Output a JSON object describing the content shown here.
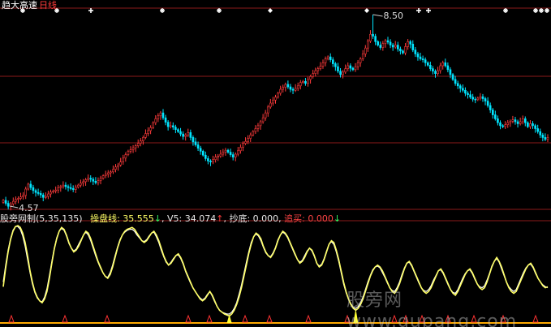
{
  "header": {
    "name": "趋大高速",
    "period": "日线"
  },
  "indicator": {
    "name": "股旁网制",
    "params": "(5,35,135)",
    "lines": [
      {
        "key": "操盘线",
        "value": "35.555",
        "arrow": "↓",
        "arrow_dir": "down",
        "color": "#ffff66"
      },
      {
        "key": "V5",
        "value": "34.074",
        "arrow": "↑",
        "arrow_dir": "up",
        "color": "#e6e6e6"
      },
      {
        "key": "抄底",
        "value": "0.000",
        "arrow": "",
        "arrow_dir": "",
        "color": "#ff66ff"
      },
      {
        "key": "追买",
        "value": "0.000",
        "arrow": "↓",
        "arrow_dir": "down",
        "color": "#ff4444"
      }
    ]
  },
  "watermark": "股旁网 www.gupang.com",
  "colors": {
    "up": "#ff3b3b",
    "down": "#00e5ff",
    "grid": "#8b1a1a",
    "osc_main": "#ffff66",
    "osc_signal": "#ffffff"
  },
  "chart_data": [
    {
      "type": "candlestick",
      "price_min": 4.57,
      "price_max": 8.5,
      "annotations": [
        {
          "text": "8.50",
          "bar": 148,
          "value": 8.5
        },
        {
          "text": "4.57",
          "bar": 2,
          "value": 4.57
        }
      ],
      "close": [
        4.72,
        4.66,
        4.6,
        4.65,
        4.7,
        4.74,
        4.76,
        4.79,
        4.82,
        4.95,
        5.05,
        4.98,
        4.92,
        4.88,
        4.86,
        4.83,
        4.78,
        4.8,
        4.85,
        4.89,
        4.91,
        4.93,
        4.98,
        5.0,
        5.03,
        5.0,
        4.98,
        4.96,
        4.94,
        4.99,
        5.03,
        5.07,
        5.1,
        5.14,
        5.17,
        5.15,
        5.11,
        5.08,
        5.12,
        5.17,
        5.22,
        5.25,
        5.28,
        5.3,
        5.35,
        5.4,
        5.44,
        5.5,
        5.58,
        5.65,
        5.72,
        5.75,
        5.79,
        5.83,
        5.88,
        5.93,
        6.0,
        6.08,
        6.14,
        6.2,
        6.3,
        6.38,
        6.44,
        6.5,
        6.4,
        6.31,
        6.22,
        6.24,
        6.21,
        6.16,
        6.12,
        6.07,
        6.02,
        6.05,
        6.1,
        6.0,
        5.91,
        5.85,
        5.78,
        5.72,
        5.64,
        5.57,
        5.52,
        5.5,
        5.55,
        5.6,
        5.62,
        5.66,
        5.7,
        5.74,
        5.7,
        5.65,
        5.6,
        5.66,
        5.73,
        5.8,
        5.88,
        5.92,
        5.98,
        6.05,
        6.12,
        6.18,
        6.24,
        6.32,
        6.4,
        6.5,
        6.62,
        6.7,
        6.76,
        6.82,
        6.9,
        6.98,
        7.02,
        7.08,
        7.03,
        6.98,
        6.96,
        7.0,
        7.05,
        7.12,
        7.14,
        7.1,
        7.18,
        7.24,
        7.3,
        7.36,
        7.4,
        7.45,
        7.52,
        7.6,
        7.64,
        7.58,
        7.5,
        7.44,
        7.35,
        7.28,
        7.33,
        7.4,
        7.46,
        7.41,
        7.38,
        7.44,
        7.52,
        7.6,
        7.7,
        7.82,
        7.96,
        8.1,
        8.06,
        7.95,
        7.88,
        7.83,
        7.91,
        7.97,
        7.94,
        7.88,
        7.84,
        7.88,
        7.8,
        7.76,
        7.72,
        7.85,
        7.95,
        7.9,
        7.78,
        7.7,
        7.64,
        7.6,
        7.58,
        7.52,
        7.47,
        7.4,
        7.35,
        7.3,
        7.36,
        7.46,
        7.52,
        7.46,
        7.38,
        7.28,
        7.18,
        7.1,
        7.05,
        7.0,
        6.96,
        6.9,
        6.87,
        6.82,
        6.78,
        6.77,
        6.8,
        6.83,
        6.79,
        6.74,
        6.65,
        6.56,
        6.46,
        6.38,
        6.3,
        6.24,
        6.22,
        6.26,
        6.3,
        6.33,
        6.36,
        6.32,
        6.28,
        6.32,
        6.38,
        6.3,
        6.22,
        6.28,
        6.24,
        6.18,
        6.12,
        6.05,
        6.0,
        5.96,
        6.0
      ]
    },
    {
      "type": "line",
      "series": [
        {
          "name": "操盘线",
          "values": [
            35,
            55,
            72,
            85,
            94,
            99,
            100,
            98,
            92,
            82,
            68,
            52,
            40,
            30,
            24,
            20,
            18,
            22,
            30,
            44,
            60,
            75,
            86,
            94,
            98,
            96,
            90,
            82,
            76,
            72,
            74,
            78,
            84,
            90,
            94,
            92,
            86,
            78,
            70,
            62,
            56,
            50,
            46,
            44,
            48,
            56,
            66,
            76,
            84,
            90,
            94,
            96,
            97,
            98,
            96,
            92,
            88,
            84,
            82,
            84,
            88,
            92,
            94,
            90,
            84,
            76,
            68,
            62,
            58,
            60,
            64,
            68,
            70,
            66,
            60,
            52,
            46,
            40,
            34,
            30,
            26,
            22,
            20,
            22,
            26,
            30,
            26,
            20,
            14,
            10,
            8,
            6,
            5,
            4,
            6,
            10,
            16,
            24,
            34,
            46,
            58,
            70,
            80,
            88,
            92,
            90,
            86,
            78,
            72,
            68,
            66,
            70,
            76,
            84,
            90,
            94,
            92,
            88,
            82,
            76,
            70,
            64,
            60,
            62,
            66,
            72,
            76,
            74,
            68,
            60,
            56,
            58,
            64,
            72,
            80,
            84,
            82,
            74,
            64,
            52,
            40,
            30,
            22,
            16,
            12,
            10,
            12,
            16,
            22,
            30,
            38,
            46,
            52,
            56,
            58,
            56,
            52,
            46,
            40,
            34,
            30,
            28,
            32,
            38,
            46,
            54,
            60,
            62,
            58,
            52,
            46,
            40,
            34,
            30,
            28,
            30,
            34,
            40,
            46,
            52,
            54,
            50,
            44,
            38,
            32,
            28,
            26,
            30,
            36,
            42,
            48,
            52,
            54,
            50,
            44,
            38,
            34,
            32,
            34,
            40,
            48,
            56,
            62,
            66,
            62,
            56,
            48,
            40,
            34,
            30,
            28,
            30,
            36,
            42,
            48,
            54,
            58,
            60,
            56,
            50,
            44,
            40,
            36,
            34,
            35
          ]
        },
        {
          "name": "V5",
          "values": [
            40,
            58,
            74,
            86,
            95,
            99,
            99,
            96,
            89,
            78,
            64,
            50,
            38,
            29,
            23,
            20,
            19,
            24,
            33,
            47,
            62,
            76,
            87,
            94,
            97,
            95,
            89,
            81,
            76,
            73,
            75,
            80,
            85,
            90,
            93,
            90,
            84,
            76,
            68,
            61,
            55,
            50,
            46,
            45,
            50,
            58,
            68,
            77,
            85,
            90,
            93,
            95,
            96,
            96,
            94,
            90,
            87,
            84,
            83,
            85,
            89,
            92,
            93,
            88,
            82,
            74,
            67,
            61,
            58,
            61,
            65,
            68,
            69,
            65,
            59,
            51,
            45,
            39,
            34,
            30,
            26,
            23,
            21,
            23,
            27,
            30,
            25,
            19,
            14,
            10,
            8,
            7,
            6,
            6,
            8,
            12,
            18,
            27,
            37,
            49,
            61,
            72,
            82,
            88,
            91,
            89,
            84,
            77,
            71,
            68,
            67,
            71,
            77,
            85,
            90,
            93,
            91,
            87,
            81,
            75,
            69,
            64,
            61,
            63,
            68,
            73,
            76,
            73,
            67,
            60,
            57,
            59,
            65,
            73,
            80,
            83,
            80,
            72,
            62,
            50,
            38,
            29,
            22,
            17,
            13,
            12,
            14,
            18,
            24,
            32,
            40,
            47,
            53,
            56,
            57,
            55,
            50,
            45,
            39,
            34,
            31,
            30,
            34,
            40,
            48,
            55,
            60,
            61,
            57,
            51,
            45,
            39,
            34,
            31,
            30,
            32,
            36,
            42,
            47,
            52,
            53,
            49,
            43,
            37,
            32,
            29,
            28,
            32,
            38,
            44,
            49,
            52,
            53,
            49,
            43,
            38,
            35,
            34,
            36,
            42,
            49,
            57,
            62,
            65,
            61,
            54,
            47,
            40,
            35,
            32,
            30,
            32,
            38,
            44,
            50,
            55,
            58,
            59,
            55,
            49,
            44,
            40,
            37,
            35,
            34
          ]
        }
      ]
    }
  ]
}
